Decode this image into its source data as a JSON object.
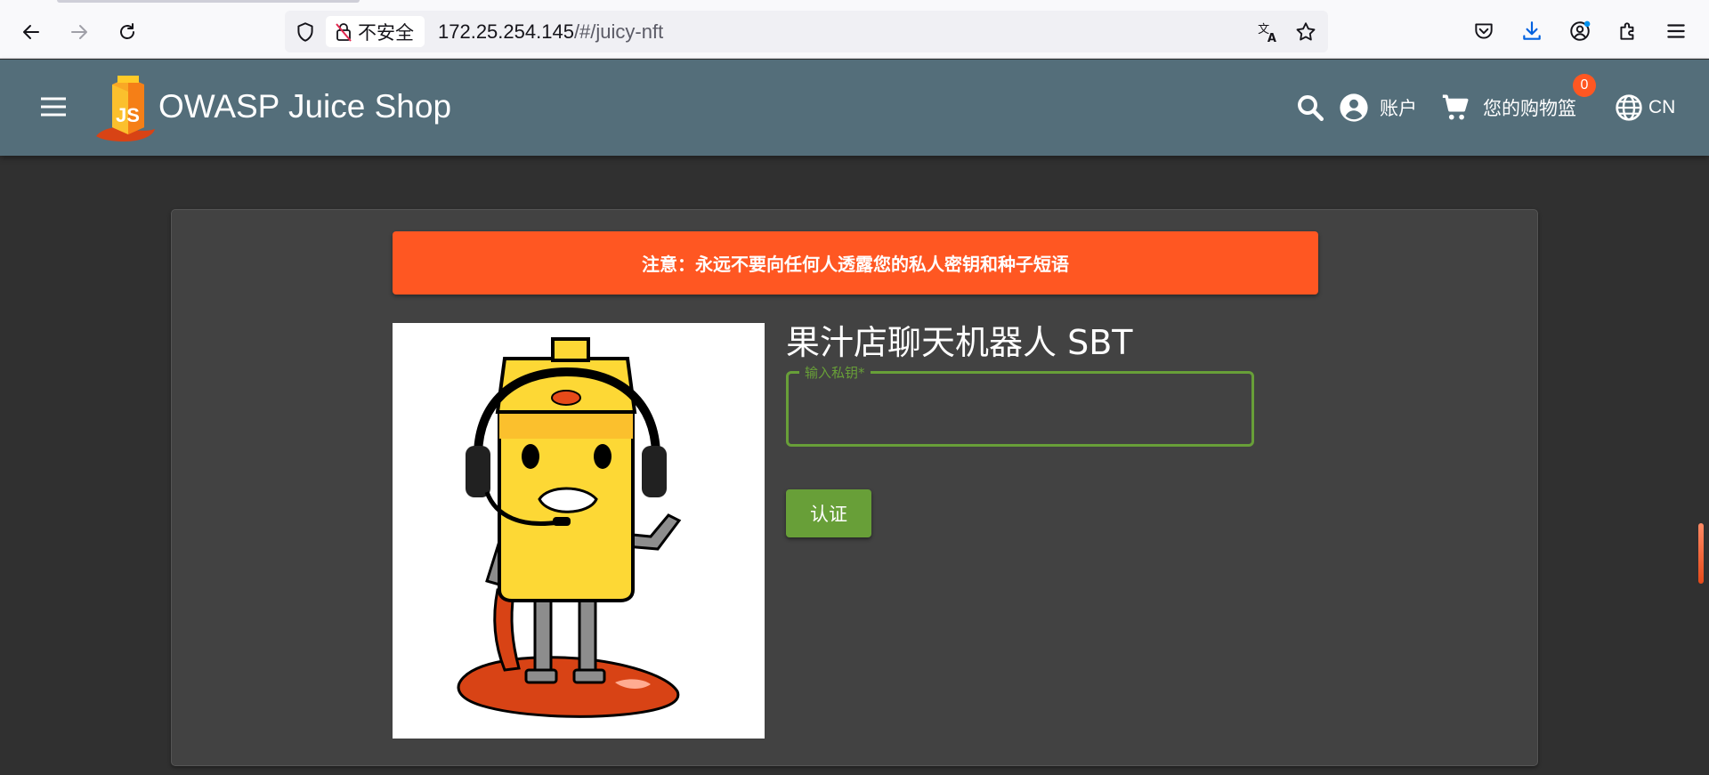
{
  "browser": {
    "security_label": "不安全",
    "url_host": "172.25.254.145",
    "url_path": "/#/juicy-nft"
  },
  "app": {
    "title": "OWASP Juice Shop",
    "account_label": "账户",
    "basket_label": "您的购物篮",
    "basket_count": "0",
    "language_label": "CN",
    "logo_letters": "JS"
  },
  "main": {
    "warning": "注意：永远不要向任何人透露您的私人密钥和种子短语",
    "nft_title": "果汁店聊天机器人 SBT",
    "key_field": {
      "label": "输入私钥*",
      "value": ""
    },
    "verify_label": "认证"
  },
  "colors": {
    "toolbar": "#546e7a",
    "background": "#303030",
    "card": "#424242",
    "warning": "#ff5722",
    "accent": "#689f38"
  }
}
